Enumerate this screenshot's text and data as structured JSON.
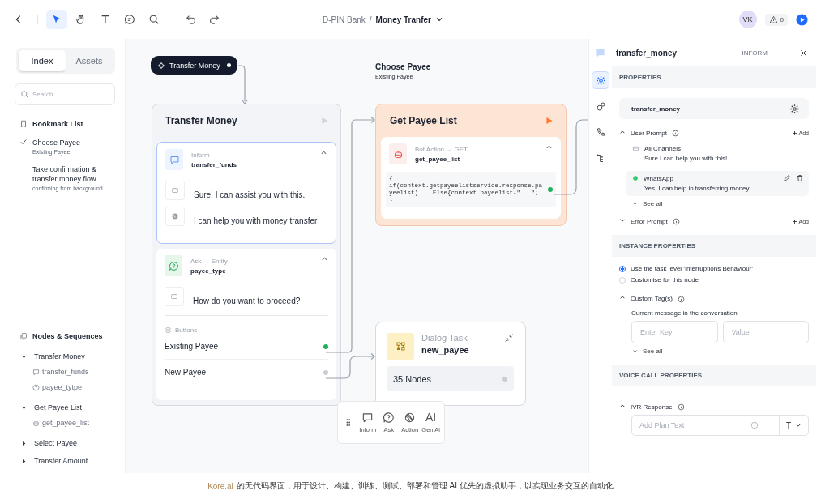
{
  "topbar": {
    "tools": [
      {
        "kind": "pointer",
        "selected": true
      },
      {
        "kind": "hand",
        "selected": false
      },
      {
        "kind": "text",
        "selected": false
      },
      {
        "kind": "comment",
        "selected": false
      },
      {
        "kind": "search",
        "selected": false
      }
    ],
    "breadcrumb": {
      "workspace": "D-PIN Bank",
      "separator": "/",
      "flow": "Money Tranfer"
    },
    "user": {
      "initials": "VK"
    },
    "alerts": {
      "count": "0"
    }
  },
  "sidebar": {
    "tabs": [
      {
        "label": "Index",
        "selected": true
      },
      {
        "label": "Assets",
        "selected": false
      }
    ],
    "search": {
      "placeholder": "Search"
    },
    "bookmarks": {
      "title": "Bookmark List",
      "items": [
        {
          "title": "Choose Payee",
          "subtitle": "Existing Payee",
          "checked": true
        },
        {
          "title": "Take confirmation & transfer money flow",
          "subtitle": "confirming from background",
          "checked": false
        }
      ]
    },
    "nodes": {
      "title": "Nodes & Sequences",
      "groups": [
        {
          "label": "Transfer Money",
          "expanded": true,
          "children": [
            {
              "label": "transfer_funds",
              "kind": "inform"
            },
            {
              "label": "payee_tytpe",
              "kind": "ask"
            }
          ]
        },
        {
          "label": "Get Payee List",
          "expanded": true,
          "children": [
            {
              "label": "get_payee_list",
              "kind": "action"
            }
          ]
        },
        {
          "label": "Select Payee",
          "expanded": false
        },
        {
          "label": "Transfer Amount",
          "expanded": false
        }
      ]
    }
  },
  "canvas": {
    "start": {
      "label": "Transfer Money"
    },
    "group_label": {
      "title": "Choose Payee",
      "subtitle": "Existing Payee"
    },
    "transfer_node": {
      "title": "Transfer Money",
      "running": false,
      "inform": {
        "type": "Inform",
        "name": "transfer_funds",
        "expanded": true,
        "messages": [
          {
            "kind": "all",
            "text": "Sure! I can assist you with this."
          },
          {
            "kind": "whatsapp",
            "text": "I can help you with money transfer"
          }
        ]
      },
      "ask": {
        "type": "Ask → Entity",
        "name": "payee_type",
        "expanded": true,
        "messages": [
          {
            "kind": "all",
            "text": "How do you want to proceed?"
          }
        ],
        "buttons_label": "Buttons",
        "buttons": [
          {
            "label": "Existing Payee",
            "color": "#22b05a"
          },
          {
            "label": "New Payee",
            "color": "#c9ced6"
          }
        ]
      }
    },
    "action_node": {
      "title": "Get Payee List",
      "running": true,
      "type": "Bot Action → GET",
      "name": "get_payee_list",
      "expanded": true,
      "code": "{\nif(context.getpayeelistservice.response.pa\nyeelist)... Else{context.payeelist-\"...\";\n}"
    },
    "dialog_node": {
      "type": "Dialog Task",
      "name": "new_payee",
      "count": "35 Nodes"
    },
    "palette": [
      {
        "kind": "inform",
        "label": "Inform"
      },
      {
        "kind": "ask",
        "label": "Ask"
      },
      {
        "kind": "action",
        "label": "Action"
      },
      {
        "kind": "genai",
        "label": "Gen Ai",
        "glyph": "AI"
      }
    ]
  },
  "panel": {
    "title": "transfer_money",
    "type": "INFORM",
    "rail": [
      {
        "kind": "settings",
        "selected": true
      },
      {
        "kind": "connections",
        "selected": false
      },
      {
        "kind": "phone",
        "selected": false
      },
      {
        "kind": "tree",
        "selected": false
      }
    ],
    "properties": {
      "heading": "PROPERTIES",
      "name": "transfer_money",
      "user_prompt": {
        "label": "User Prompt",
        "expanded": true,
        "add": "Add",
        "see_all": "See all",
        "items": [
          {
            "kind": "all",
            "channel": "All Channels",
            "text": "Sure I can help you with this!",
            "selected": false
          },
          {
            "kind": "whatsapp",
            "channel": "WhatsApp",
            "text": "Yes, I can help in transferring money!",
            "selected": true
          }
        ]
      },
      "error_prompt": {
        "label": "Error Prompt",
        "expanded": false,
        "add": "Add"
      }
    },
    "instance": {
      "heading": "INSTANCE PROPERTIES",
      "options": [
        {
          "label": "Use the task level ‘interruptions Behaviour’",
          "selected": true
        },
        {
          "label": "Customise for this node",
          "selected": false
        }
      ],
      "custom_tags": {
        "label": "Custom Tag(s)",
        "expanded": true,
        "hint": "Current message in the conversation",
        "key_placeholder": "Enter Key",
        "value_placeholder": "Value",
        "see_all": "See all"
      }
    },
    "voice": {
      "heading": "VOICE CALL PROPERTIES",
      "ivr": {
        "label": "IVR Response",
        "expanded": true,
        "placeholder": "Add Plan Text",
        "format_label": "T"
      }
    }
  },
  "caption": {
    "link": "Kore.ai",
    "text": "的无代码界面，用于设计、构建、训练、测试、部署和管理 AI 优先的虚拟助手，以实现业务交互的自动化"
  }
}
